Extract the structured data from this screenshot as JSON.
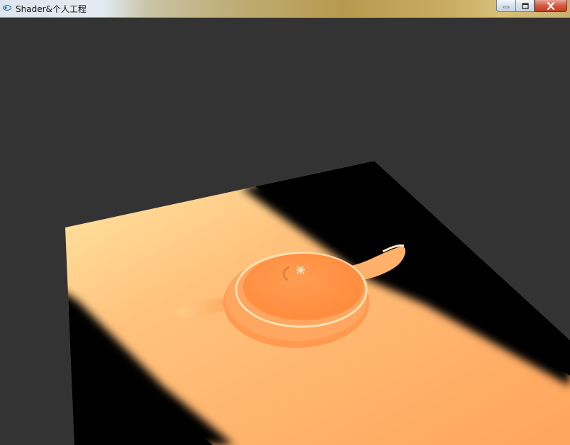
{
  "window": {
    "title": "Shader&个人工程",
    "controls": {
      "minimize": "minimize-icon",
      "maximize": "maximize-icon",
      "close": "close-icon"
    }
  },
  "viewport": {
    "background": "#333333",
    "scene": {
      "floor_color": "#ffb065",
      "shadow_color": "#000000",
      "teapot_color": "#ff9448"
    }
  }
}
